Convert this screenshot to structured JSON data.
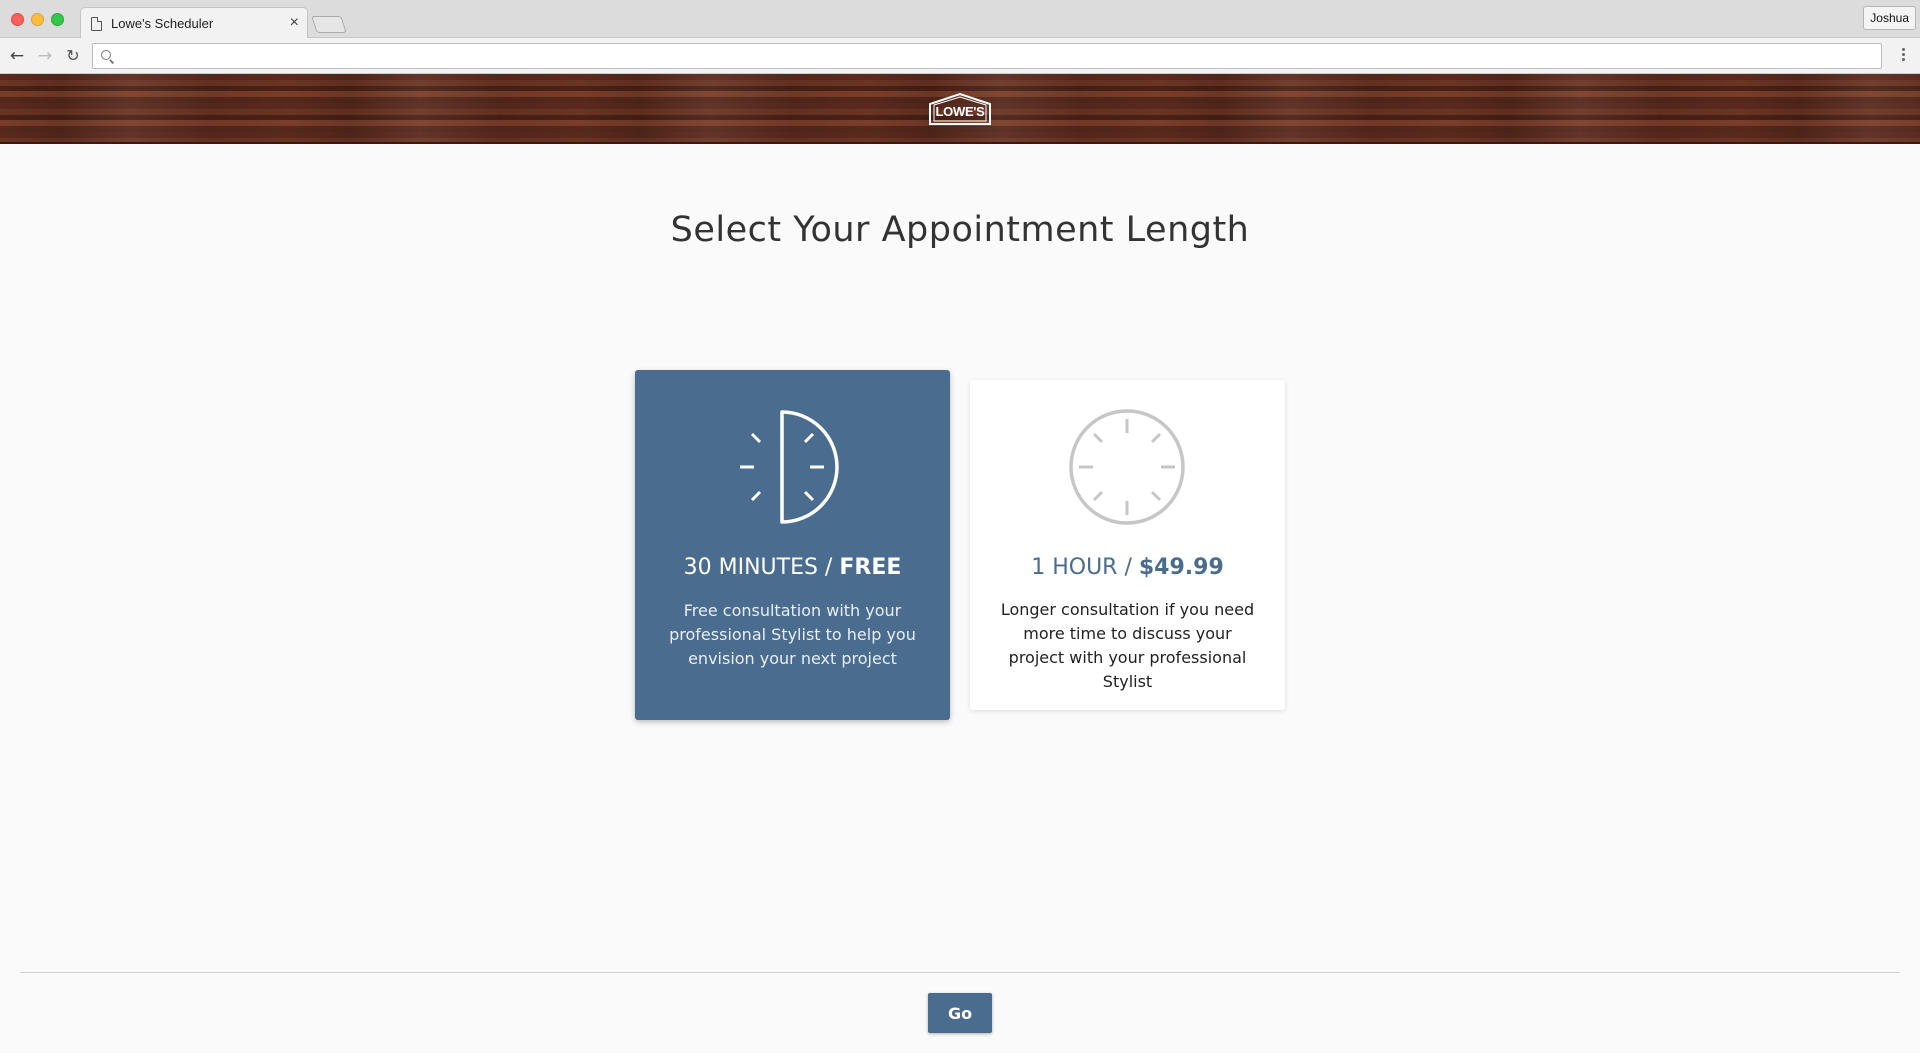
{
  "browser": {
    "tab_title": "Lowe's Scheduler",
    "tab_close": "×",
    "profile_name": "Joshua",
    "address_value": "",
    "icons": {
      "back": "arrow-left",
      "forward": "arrow-right",
      "reload": "reload",
      "search": "magnifier",
      "menu": "vertical-dots"
    }
  },
  "header": {
    "logo_text": "LOWE'S"
  },
  "main": {
    "title": "Select Your Appointment Length",
    "options": [
      {
        "icon": "half-clock-icon",
        "duration": "30 MINUTES",
        "separator": " / ",
        "price": "FREE",
        "description": "Free consultation with your professional Stylist to help you envision your next project",
        "selected": true
      },
      {
        "icon": "clock-icon",
        "duration": "1 HOUR",
        "separator": " / ",
        "price": "$49.99",
        "description": "Longer consultation if you need more time to discuss your project with your professional Stylist",
        "selected": false
      }
    ]
  },
  "footer": {
    "go_label": "Go"
  },
  "colors": {
    "accent": "#4a6c8f",
    "selected_text": "#ffffff",
    "clock_gray": "#c6c6c6",
    "title_text": "#333333"
  }
}
